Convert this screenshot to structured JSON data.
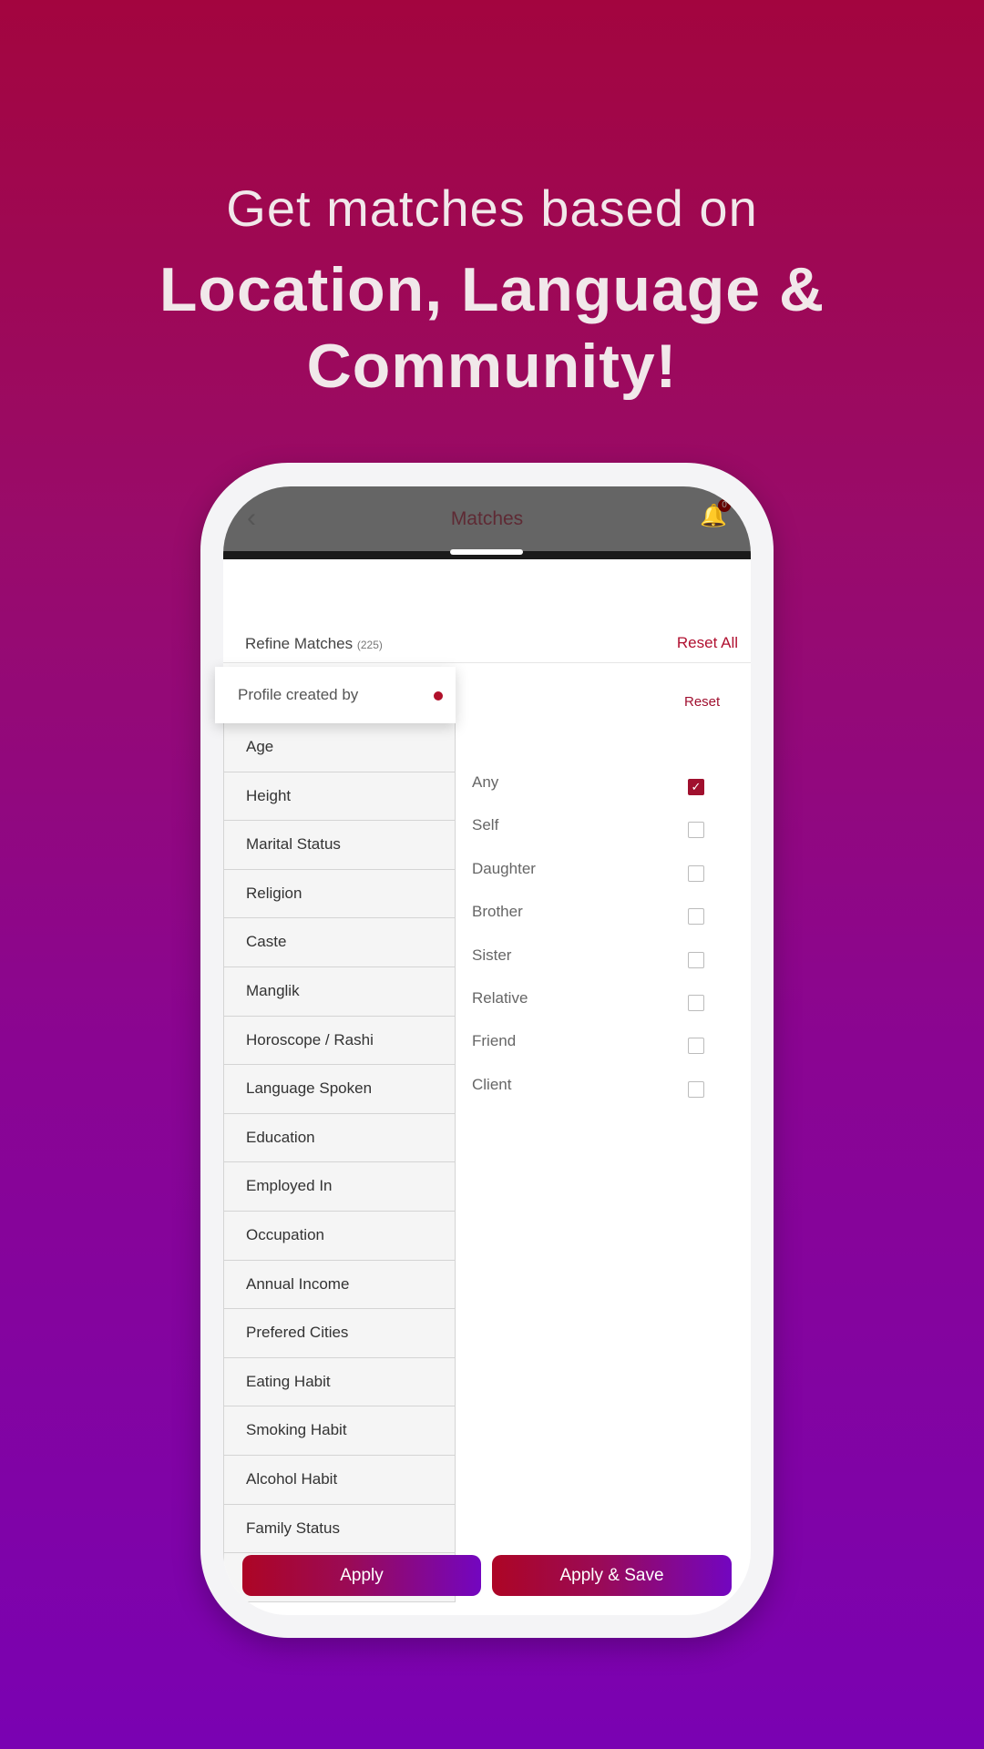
{
  "promo": {
    "line1": "Get matches based on",
    "line2": "Location, Language &",
    "line3": "Community!"
  },
  "header": {
    "title": "Matches",
    "back_icon": "chevron-left-icon",
    "bell_icon": "bell-icon",
    "notification_count": "0"
  },
  "refine": {
    "label": "Refine Matches",
    "count": "(225)",
    "reset_all": "Reset All"
  },
  "selected_filter": {
    "label": "Profile created by",
    "reset": "Reset"
  },
  "filters": [
    "Age",
    "Height",
    "Marital Status",
    "Religion",
    "Caste",
    "Manglik",
    "Horoscope / Rashi",
    "Language Spoken",
    "Education",
    "Employed In",
    "Occupation",
    "Annual Income",
    "Prefered Cities",
    "Eating Habit",
    "Smoking Habit",
    "Alcohol Habit",
    "Family Status"
  ],
  "options": [
    {
      "label": "Any",
      "checked": true
    },
    {
      "label": "Self",
      "checked": false
    },
    {
      "label": "Daughter",
      "checked": false
    },
    {
      "label": "Brother",
      "checked": false
    },
    {
      "label": "Sister",
      "checked": false
    },
    {
      "label": "Relative",
      "checked": false
    },
    {
      "label": "Friend",
      "checked": false
    },
    {
      "label": "Client",
      "checked": false
    }
  ],
  "buttons": {
    "apply": "Apply",
    "apply_save": "Apply & Save"
  },
  "colors": {
    "accent": "#a0102e",
    "gradient_start": "#ad0525",
    "gradient_end": "#7306c0"
  }
}
